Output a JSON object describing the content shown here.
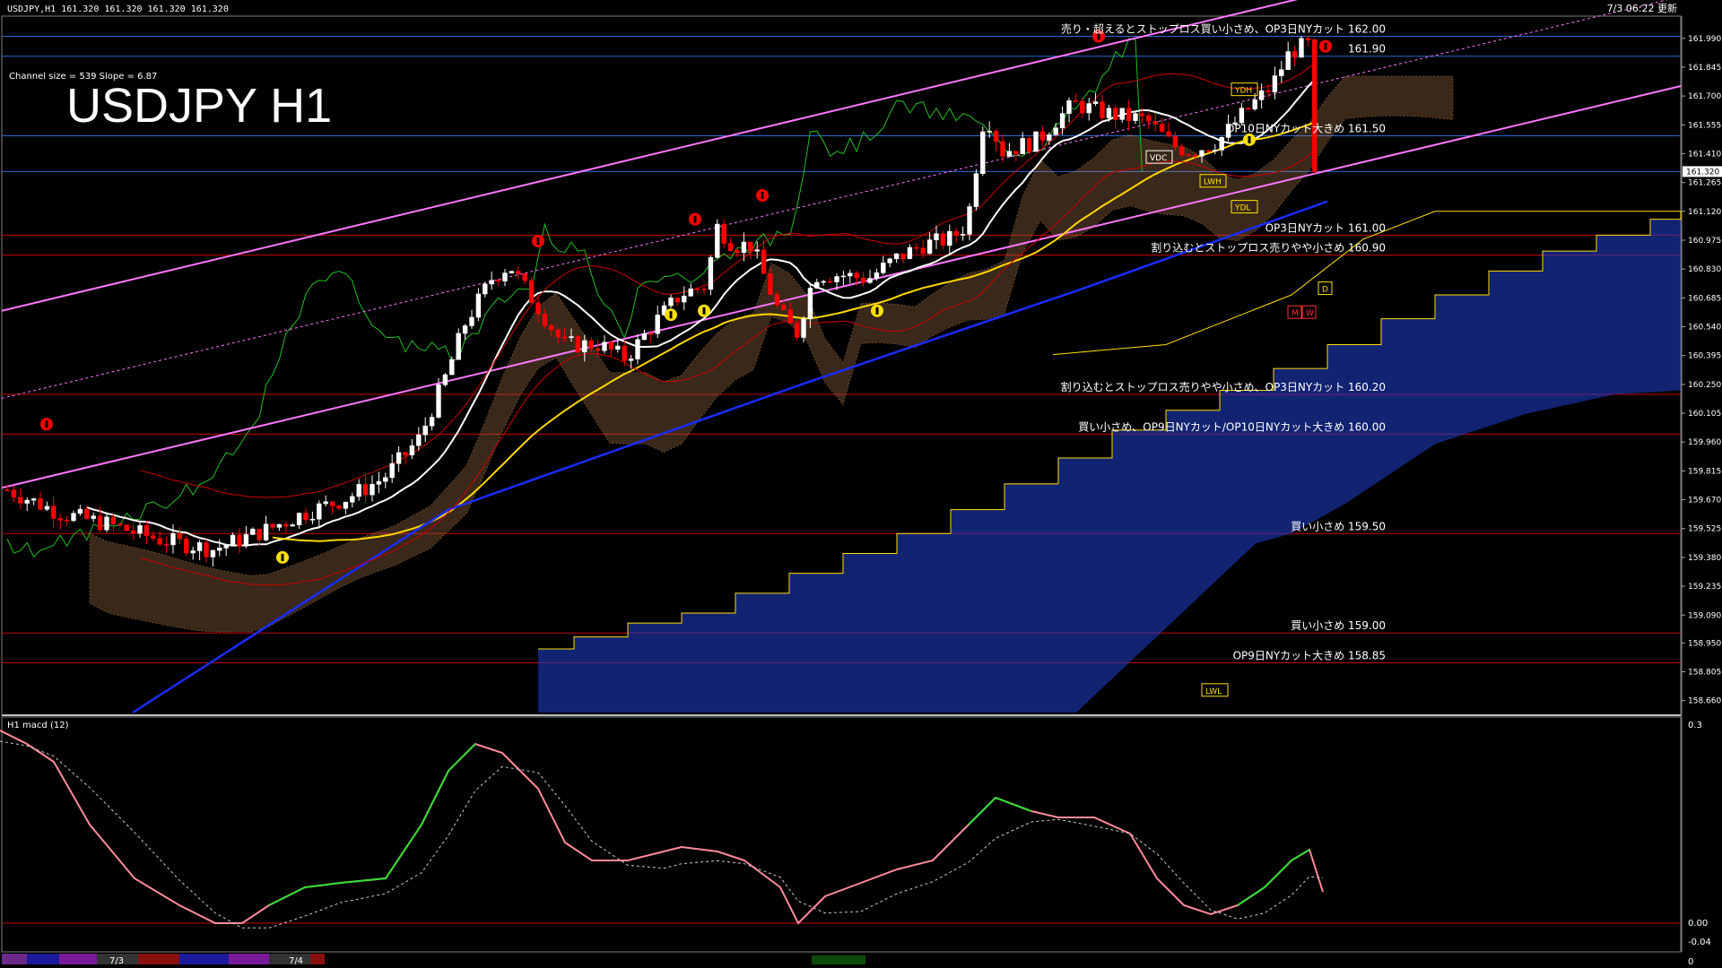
{
  "header": {
    "symbol_info": "USDJPY,H1  161.320 161.320 161.320 161.320",
    "update_time": "7/3 06:22 更新",
    "chart_title": "USDJPY H1",
    "channel_info": "Channel size = 539 Slope = 6.87"
  },
  "colors": {
    "background": "#000000",
    "grid_blue": "#2a6bd6",
    "grid_red": "#c00000",
    "channel": "#ff77ff",
    "ma_white": "#ffffff",
    "ma_yellow": "#ffd700",
    "ma_blue": "#1a2cff",
    "chikou_green": "#22c022",
    "bull_candle": "#ffffff",
    "bear_candle": "#ff0000",
    "kumo_bull": "#d2955c",
    "kumo_bear": "#2040d0",
    "macd_up": "#33dd33",
    "macd_down": "#ff8c9a",
    "signal": "#cccccc"
  },
  "macd_panel": {
    "label": "H1  macd (12)",
    "scale_top": "0.3",
    "scale_zero": "0.00",
    "scale_low": "-0.04",
    "scale_bottom": "0"
  },
  "chart_data": {
    "type": "candlestick",
    "title": "USDJPY H1",
    "ylim": [
      158.6,
      162.07
    ],
    "y_ticks": [
      "161.990",
      "161.845",
      "161.700",
      "161.555",
      "161.410",
      "161.265",
      "161.120",
      "160.975",
      "160.830",
      "160.685",
      "160.540",
      "160.395",
      "160.250",
      "160.105",
      "159.960",
      "159.815",
      "159.670",
      "159.525",
      "159.380",
      "159.235",
      "159.090",
      "158.950",
      "158.805",
      "158.660"
    ],
    "current_price": "161.320",
    "x_labels": [
      "7/3",
      "7/4"
    ],
    "levels": [
      {
        "price": 162.0,
        "kind": "blue",
        "label": "売り・超えるとストップロス買い小さめ、OP3日NYカット 162.00"
      },
      {
        "price": 161.9,
        "kind": "blue",
        "label": "161.90"
      },
      {
        "price": 161.5,
        "kind": "blue",
        "label": "OP10日NYカット大きめ 161.50"
      },
      {
        "price": 161.32,
        "kind": "blue",
        "label": ""
      },
      {
        "price": 161.0,
        "kind": "red",
        "label": "OP3日NYカット 161.00"
      },
      {
        "price": 160.9,
        "kind": "red",
        "label": "割り込むとストップロス売りやや小さめ 160.90"
      },
      {
        "price": 160.2,
        "kind": "red",
        "label": "割り込むとストップロス売りやや小さめ、OP3日NYカット 160.20"
      },
      {
        "price": 160.0,
        "kind": "red",
        "label": "買い小さめ、OP9日NYカット/OP10日NYカット大きめ 160.00"
      },
      {
        "price": 159.5,
        "kind": "red",
        "label": "買い小さめ 159.50"
      },
      {
        "price": 159.0,
        "kind": "red",
        "label": "買い小さめ 159.00"
      },
      {
        "price": 158.85,
        "kind": "red",
        "label": "OP9日NYカット大きめ 158.85"
      }
    ],
    "markers": [
      "YDH",
      "YDL",
      "VDC",
      "LWH",
      "LWL",
      "M",
      "W",
      "D"
    ]
  }
}
